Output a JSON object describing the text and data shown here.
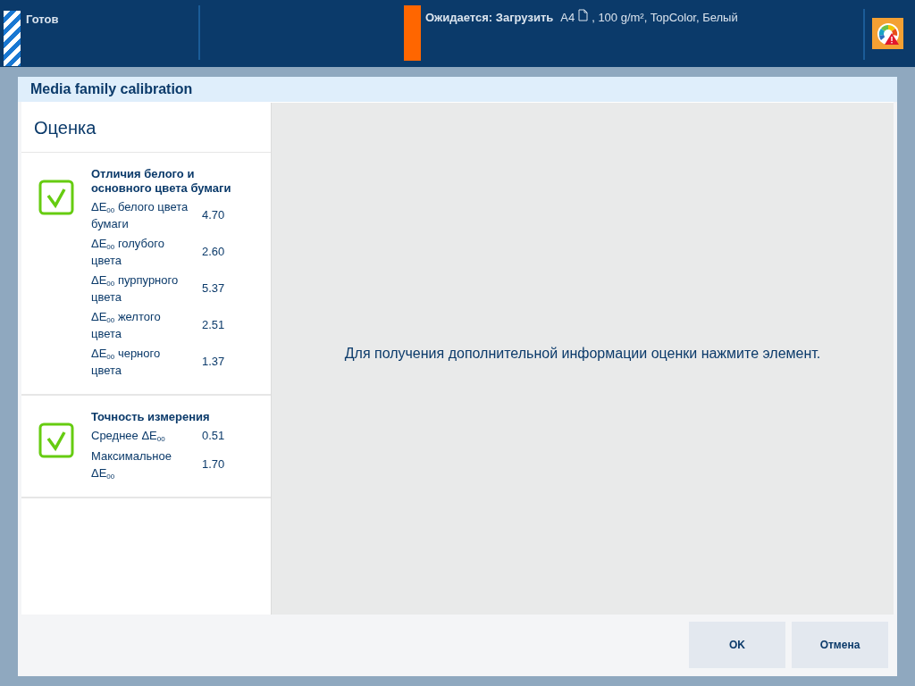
{
  "status_bar": {
    "state": "Готов",
    "job_label": "Ожидается: Загрузить",
    "media_size": "A4",
    "media_details": ", 100 g/m², TopColor, Белый"
  },
  "dialog": {
    "title": "Media family calibration",
    "panel_title": "Оценка",
    "groups": [
      {
        "title": "Отличия белого и основного цвета бумаги",
        "passed": true,
        "rows": [
          {
            "label": "ΔE$_{00}$ белого цвета бумаги",
            "value": "4.70"
          },
          {
            "label": "ΔE$_{00}$ голубого цвета",
            "value": "2.60"
          },
          {
            "label": "ΔE$_{00}$ пурпурного цвета",
            "value": "5.37"
          },
          {
            "label": "ΔE$_{00}$ желтого цвета",
            "value": "2.51"
          },
          {
            "label": "ΔE$_{00}$ черного цвета",
            "value": "1.37"
          }
        ]
      },
      {
        "title": "Точность измерения",
        "passed": true,
        "rows": [
          {
            "label": "Среднее ΔE$_{00}$",
            "value": "0.51"
          },
          {
            "label": "Максимальное ΔE$_{00}$",
            "value": "1.70"
          }
        ]
      }
    ],
    "hint": "Для получения дополнительной информации оценки нажмите элемент.",
    "buttons": [
      "OK",
      "Отмена"
    ]
  }
}
